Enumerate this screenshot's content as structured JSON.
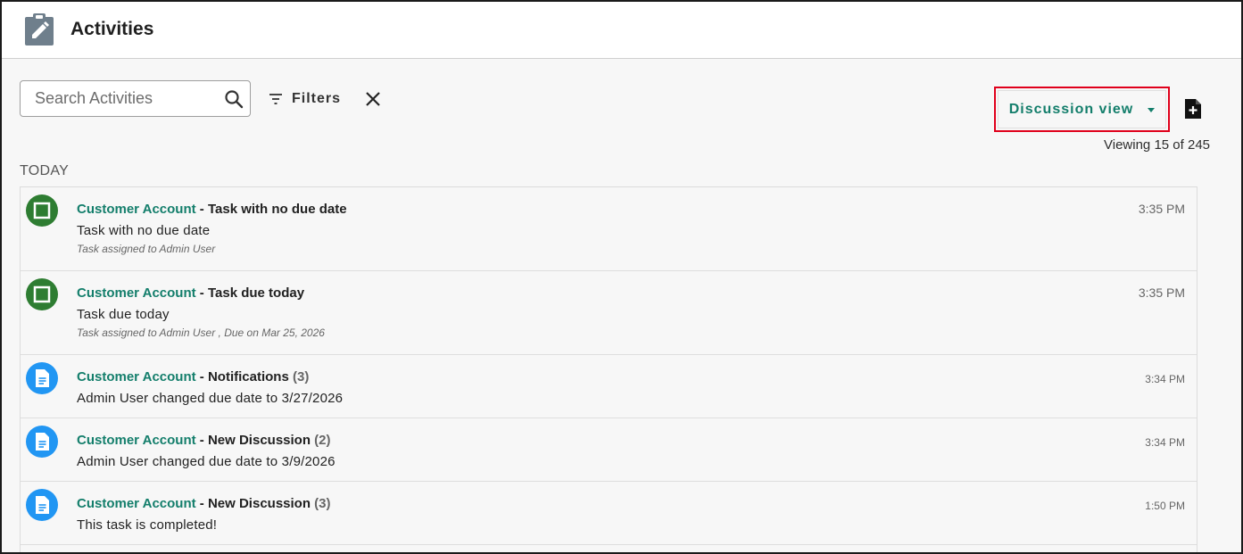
{
  "header": {
    "title": "Activities"
  },
  "toolbar": {
    "search_placeholder": "Search Activities",
    "filters_label": "Filters",
    "view_select_label": "Discussion view",
    "viewing_count": "Viewing 15 of 245"
  },
  "section": {
    "label": "TODAY"
  },
  "colors": {
    "accent": "#137e6b",
    "task_icon": "#2e7d32",
    "discussion_icon": "#2196f3",
    "highlight": "#e0001b"
  },
  "activities": [
    {
      "icon": "task-checkbox-icon",
      "account": "Customer Account",
      "sep": " - ",
      "subject": "Task with no due date",
      "count": "",
      "body": "Task with no due date",
      "meta": "Task assigned to Admin User",
      "time": "3:35 PM"
    },
    {
      "icon": "task-checkbox-icon",
      "account": "Customer Account",
      "sep": " - ",
      "subject": "Task due today",
      "count": "",
      "body": "Task due today",
      "meta": "Task assigned to Admin User , Due on Mar 25, 2026",
      "time": "3:35 PM"
    },
    {
      "icon": "document-icon",
      "account": "Customer Account",
      "sep": " - ",
      "subject": "Notifications",
      "count": " (3)",
      "body": "Admin User changed due date to 3/27/2026",
      "meta": "",
      "time": "3:34 PM"
    },
    {
      "icon": "document-icon",
      "account": "Customer Account",
      "sep": " - ",
      "subject": "New Discussion",
      "count": " (2)",
      "body": "Admin User changed due date to 3/9/2026",
      "meta": "",
      "time": "3:34 PM"
    },
    {
      "icon": "document-icon",
      "account": "Customer Account",
      "sep": " - ",
      "subject": "New Discussion",
      "count": " (3)",
      "body": "This task is completed!",
      "meta": "",
      "time": "1:50 PM"
    }
  ]
}
